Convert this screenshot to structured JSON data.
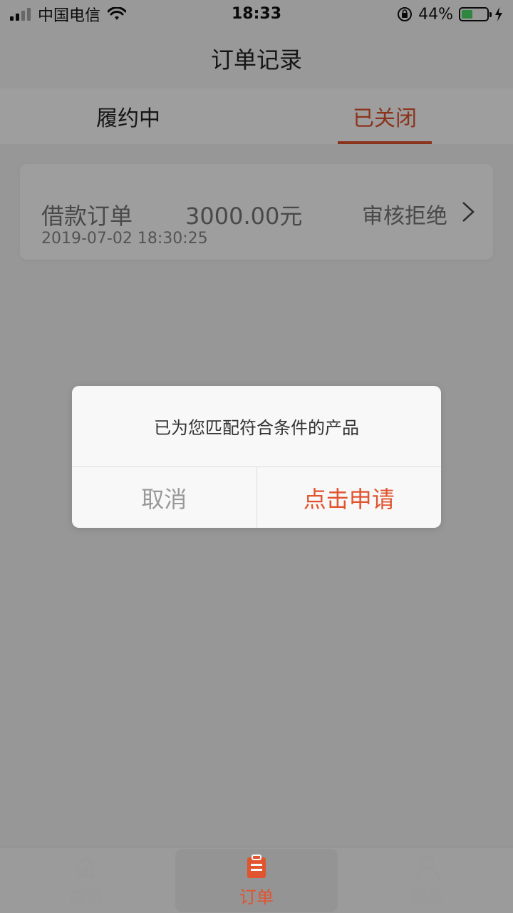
{
  "status_bar": {
    "carrier": "中国电信",
    "time": "18:33",
    "battery": "44%",
    "battery_level": 0.44
  },
  "header": {
    "title": "订单记录"
  },
  "tabs": [
    {
      "label": "履约中",
      "active": false
    },
    {
      "label": "已关闭",
      "active": true
    }
  ],
  "order": {
    "title": "借款订单",
    "amount": "3000.00元",
    "status": "审核拒绝",
    "time": "2019-07-02 18:30:25"
  },
  "dialog": {
    "message": "已为您匹配符合条件的产品",
    "cancel": "取消",
    "confirm": "点击申请"
  },
  "bottom_nav": [
    {
      "label": "首页",
      "icon": "home-icon",
      "active": false
    },
    {
      "label": "订单",
      "icon": "clipboard-icon",
      "active": true
    },
    {
      "label": "我的",
      "icon": "user-icon",
      "active": false
    }
  ],
  "colors": {
    "accent": "#e0542f",
    "overlay": "rgba(0,0,0,0.38)"
  }
}
